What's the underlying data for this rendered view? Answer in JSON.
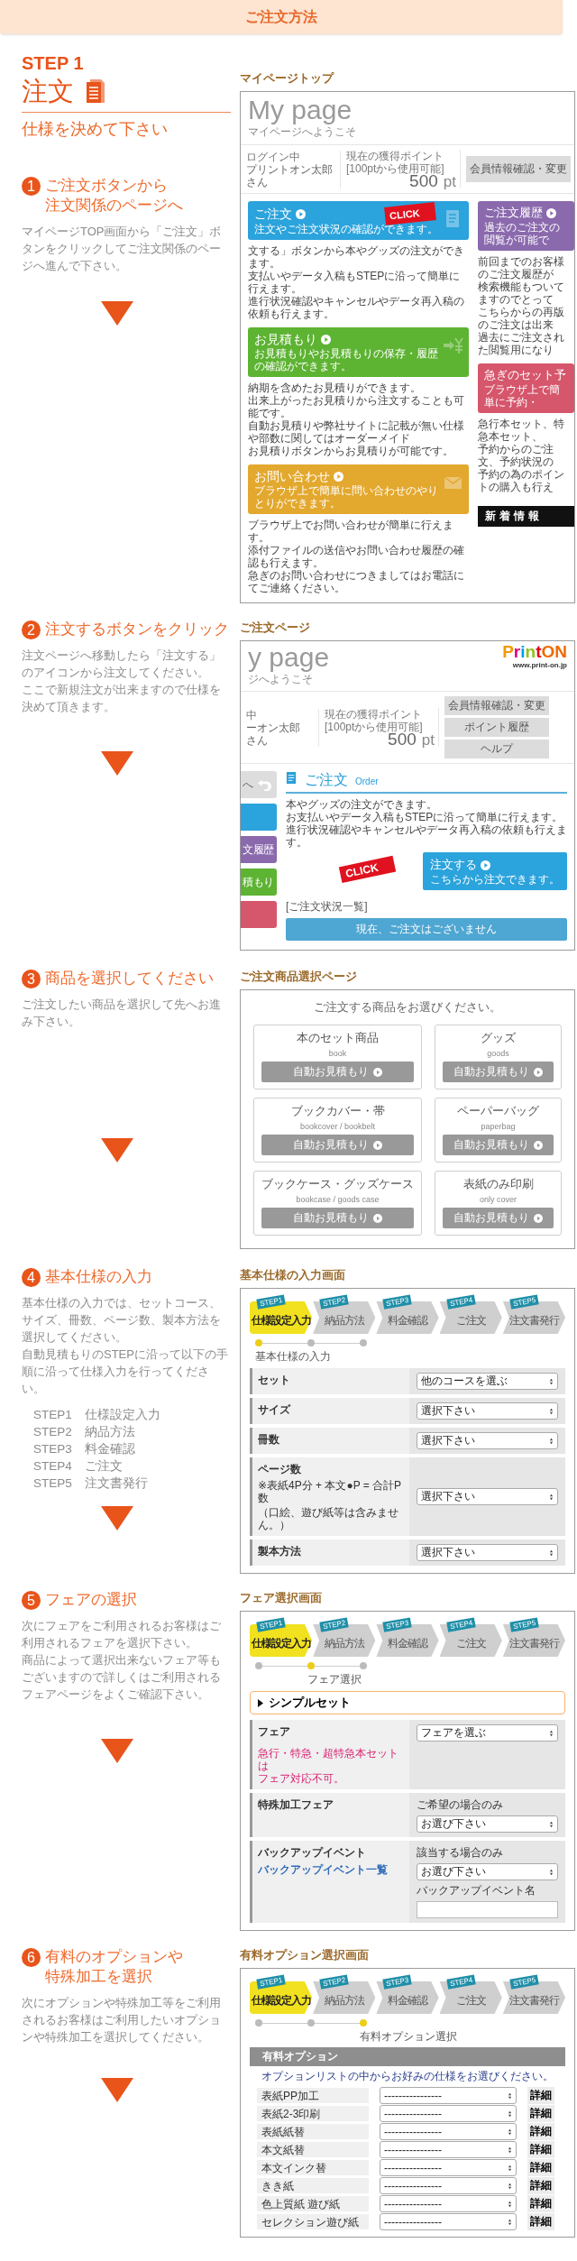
{
  "header": {
    "title": "ご注文方法"
  },
  "intro": {
    "step_label": "STEP 1",
    "title": "注文",
    "subtitle": "仕様を決めて下さい"
  },
  "steps": [
    {
      "number": "1",
      "title_lines": [
        "ご注文ボタンから",
        "注文関係のページへ"
      ],
      "paragraphs": [
        "マイページTOP画面から「ご注文」ボタンをクリックしてご注文関係のページへ進んで下さい。"
      ],
      "screen": {
        "kind": "mypage",
        "caption": "マイページトップ",
        "page_title": "My page",
        "welcome": "マイページへようこそ",
        "login_label": "ログイン中",
        "user_name": "プリントオン太郎",
        "honorific": "さん",
        "points_label": "現在の獲得ポイント",
        "points_note": "[100ptから使用可能]",
        "points": "500",
        "points_unit": "pt",
        "buttons": [
          "会員情報確認・変更"
        ],
        "left_cards": [
          {
            "title": "ご注文",
            "subtitle": "注文やご注文状況の確認ができます。",
            "color": "#2ba3dc",
            "lines": [
              "文する」ボタンから本やグッズの注文ができます。",
              "支払いやデータ入稿もSTEPに沿って簡単に行えます。",
              "進行状況確認やキャンセルやデータ再入稿の依頼も行えます。"
            ]
          },
          {
            "title": "お見積もり",
            "subtitle": "お見積もりやお見積もりの保存・履歴の確認ができます。",
            "color": "#5db332",
            "lines": [
              "納期を含めたお見積りができます。",
              "出来上がったお見積りから注文することも可能です。",
              "自動お見積りや弊社サイトに記載が無い仕様や部数に関してはオーダーメイド",
              "お見積りボタンからお見積りが可能です。"
            ]
          },
          {
            "title": "お問い合わせ",
            "subtitle": "ブラウザ上で簡単に問い合わせのやりとりができます。",
            "color": "#e3a82e",
            "lines": [
              "ブラウザ上でお問い合わせが簡単に行えます。",
              "添付ファイルの送信やお問い合わせ履歴の確認も行えます。",
              "急ぎのお問い合わせにつきましてはお電話にてご連絡ください。"
            ]
          }
        ],
        "right_cards": [
          {
            "title": "ご注文履歴",
            "subtitle": "過去のご注文の閲覧が可能で",
            "color": "#8a69ad",
            "lines": [
              "前回までのお客様のご注文履歴が",
              "検索機能もついてますのでとって",
              "こちらからの再版のご注文は出来",
              "過去にご注文された閲覧用になり"
            ]
          },
          {
            "title": "急ぎのセット予",
            "subtitle": "ブラウザ上で簡単に予約・",
            "color": "#d6566c",
            "lines": [
              "急行本セット、特急本セット、",
              "予約からのご注文、予約状況の",
              "予約の為のポイントの購入も行え"
            ]
          }
        ],
        "news_title": "新着情報",
        "click": "CLICK"
      }
    },
    {
      "number": "2",
      "title_lines": [
        "注文するボタンをクリック"
      ],
      "paragraphs": [
        "注文ページへ移動したら「注文する」のアイコンから注文してください。",
        "ここで新規注文が出来ますので仕様を決めて頂きます。"
      ],
      "screen": {
        "kind": "order",
        "caption": "ご注文ページ",
        "page_title": "y page",
        "welcome": "ジへようこそ",
        "logo": "PrintON",
        "logo_url": "www.print-on.jp",
        "login_label": "中",
        "user_name": "ーオン太郎",
        "honorific": "さん",
        "points_label": "現在の獲得ポイント",
        "points_note": "[100ptから使用可能]",
        "points": "500",
        "points_unit": "pt",
        "buttons": [
          "会員情報確認・変更",
          "ポイント履歴",
          "ヘルプ"
        ],
        "tiles": [
          {
            "label": "へ",
            "color": "#dddddd"
          },
          {
            "color": "#2ba3dc"
          },
          {
            "label": "文履歴",
            "color": "#8a69ad"
          },
          {
            "label": "積もり",
            "color": "#5db332"
          },
          {
            "color": "#d6566c"
          }
        ],
        "section_title": "ご注文",
        "section_sub": "Order",
        "lines": [
          "本やグッズの注文ができます。",
          "お支払いやデータ入稿もSTEPに沿って簡単に行えます。",
          "進行状況確認やキャンセルやデータ再入稿の依頼も行えます。"
        ],
        "order_button": "注文する",
        "order_button_sub": "こちらから注文できます。",
        "click": "CLICK",
        "list_title": "[ご注文状況一覧]",
        "empty_message": "現在、ご注文はございません"
      }
    },
    {
      "number": "3",
      "title_lines": [
        "商品を選択してください"
      ],
      "paragraphs": [
        "ご注文したい商品を選択して先へお進み下さい。"
      ],
      "screen": {
        "kind": "products",
        "caption": "ご注文商品選択ページ",
        "prompt": "ご注文する商品をお選びください。",
        "products": [
          {
            "name": "本のセット商品",
            "sub": "book",
            "button": "自動お見積もり"
          },
          {
            "name": "グッズ",
            "sub": "goods",
            "button": "自動お見積もり"
          },
          {
            "name": "ブックカバー・帯",
            "sub": "bookcover / bookbelt",
            "button": "自動お見積もり"
          },
          {
            "name": "ペーパーバッグ",
            "sub": "paperbag",
            "button": "自動お見積もり"
          },
          {
            "name": "ブックケース・グッズケース",
            "sub": "bookcase / goods case",
            "button": "自動お見積もり"
          },
          {
            "name": "表紙のみ印刷",
            "sub": "only cover",
            "button": "自動お見積もり"
          }
        ]
      }
    },
    {
      "number": "4",
      "title_lines": [
        "基本仕様の入力"
      ],
      "paragraphs": [
        "基本仕様の入力では、セットコース、サイズ、冊数、ページ数、製本方法を選択してください。",
        "自動見積もりのSTEPに沿って以下の手順に沿って仕様入力を行ってください。"
      ],
      "step_list": [
        {
          "label": "STEP1",
          "text": "仕様設定入力"
        },
        {
          "label": "STEP2",
          "text": "納品方法"
        },
        {
          "label": "STEP3",
          "text": "料金確認"
        },
        {
          "label": "STEP4",
          "text": "ご注文"
        },
        {
          "label": "STEP5",
          "text": "注文書発行"
        }
      ],
      "screen": {
        "kind": "spec",
        "caption": "基本仕様の入力画面",
        "steps": [
          {
            "tag": "STEP1",
            "label": "仕様設定入力",
            "selected": true
          },
          {
            "tag": "STEP2",
            "label": "納品方法",
            "selected": false
          },
          {
            "tag": "STEP3",
            "label": "料金確認",
            "selected": false
          },
          {
            "tag": "STEP4",
            "label": "ご注文",
            "selected": false
          },
          {
            "tag": "STEP5",
            "label": "注文書発行",
            "selected": false
          }
        ],
        "progress": [
          {
            "selected": true
          },
          {
            "selected": false
          },
          {
            "selected": false
          }
        ],
        "progress_label": "基本仕様の入力",
        "rows": [
          {
            "label": "セット",
            "value": "他のコースを選ぶ"
          },
          {
            "label": "サイズ",
            "value": "選択下さい"
          },
          {
            "label": "冊数",
            "value": "選択下さい"
          },
          {
            "label": "ページ数",
            "note": [
              "※表紙4P分 + 本文●P = 合計P数",
              "（口絵、遊び紙等は含みません。）"
            ],
            "value": "選択下さい"
          },
          {
            "label": "製本方法",
            "value": "選択下さい"
          }
        ]
      }
    },
    {
      "number": "5",
      "title_lines": [
        "フェアの選択"
      ],
      "paragraphs": [
        "次にフェアをご利用されるお客様はご利用されるフェアを選択下さい。",
        "商品によって選択出来ないフェア等もございますので詳しくはご利用されるフェアページをよくご確認下さい。"
      ],
      "screen": {
        "kind": "fair",
        "caption": "フェア選択画面",
        "steps": [
          {
            "tag": "STEP1",
            "label": "仕様設定入力",
            "selected": true
          },
          {
            "tag": "STEP2",
            "label": "納品方法",
            "selected": false
          },
          {
            "tag": "STEP3",
            "label": "料金確認",
            "selected": false
          },
          {
            "tag": "STEP4",
            "label": "ご注文",
            "selected": false
          },
          {
            "tag": "STEP5",
            "label": "注文書発行",
            "selected": false
          }
        ],
        "progress": [
          {
            "selected": false
          },
          {
            "selected": true
          },
          {
            "selected": false
          }
        ],
        "progress_label": "フェア選択",
        "set_title": "シンプルセット",
        "rows": [
          {
            "label": "フェア",
            "note": [
              "急行・特急・超特急本セットは",
              "フェア対応不可。"
            ],
            "fields": [
              {
                "kind": "select",
                "value": "フェアを選ぶ"
              }
            ]
          },
          {
            "label": "特殊加工フェア",
            "fields": [
              {
                "kind": "caption",
                "text": "ご希望の場合のみ"
              },
              {
                "kind": "select",
                "value": "お選び下さい"
              }
            ]
          },
          {
            "label": "バックアップイベント",
            "link": "バックアップイベント一覧",
            "fields": [
              {
                "kind": "caption",
                "text": "該当する場合のみ"
              },
              {
                "kind": "select",
                "value": "お選び下さい"
              },
              {
                "kind": "caption",
                "text": "バックアップイベント名"
              },
              {
                "kind": "input"
              }
            ]
          }
        ]
      }
    },
    {
      "number": "6",
      "title_lines": [
        "有料のオプションや",
        "特殊加工を選択"
      ],
      "paragraphs": [
        "次にオプションや特殊加工等をご利用されるお客様はご利用したいオプションや特殊加工を選択してください。"
      ],
      "screen": {
        "kind": "options",
        "caption": "有料オプション選択画面",
        "steps": [
          {
            "tag": "STEP1",
            "label": "仕様設定入力",
            "selected": true
          },
          {
            "tag": "STEP2",
            "label": "納品方法",
            "selected": false
          },
          {
            "tag": "STEP3",
            "label": "料金確認",
            "selected": false
          },
          {
            "tag": "STEP4",
            "label": "ご注文",
            "selected": false
          },
          {
            "tag": "STEP5",
            "label": "注文書発行",
            "selected": false
          }
        ],
        "progress": [
          {
            "selected": false
          },
          {
            "selected": false
          },
          {
            "selected": true
          }
        ],
        "progress_label": "有料オプション選択",
        "bar_title": "有料オプション",
        "instruction": "オプションリストの中からお好みの仕様をお選びください。",
        "options": [
          {
            "label": "表紙PP加工",
            "value": "----------------",
            "button": "詳細"
          },
          {
            "label": "表紙2-3印刷",
            "value": "----------------",
            "button": "詳細"
          },
          {
            "label": "表紙紙替",
            "value": "----------------",
            "button": "詳細"
          },
          {
            "label": "本文紙替",
            "value": "----------------",
            "button": "詳細"
          },
          {
            "label": "本文インク替",
            "value": "----------------",
            "button": "詳細"
          },
          {
            "label": "きき紙",
            "value": "----------------",
            "button": "詳細"
          },
          {
            "label": "色上質紙 遊び紙",
            "value": "----------------",
            "button": "詳細"
          },
          {
            "label": "セレクション遊び紙",
            "value": "----------------",
            "button": "詳細"
          }
        ]
      }
    }
  ]
}
